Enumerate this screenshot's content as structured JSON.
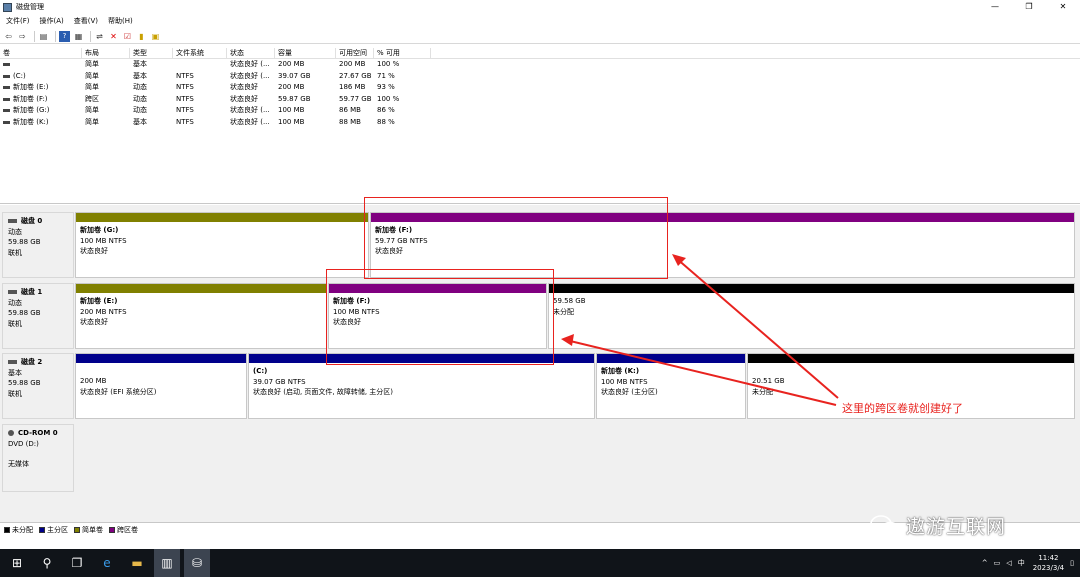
{
  "window": {
    "title": "磁盘管理",
    "controls": [
      "—",
      "❐",
      "✕"
    ]
  },
  "menu": [
    "文件(F)",
    "操作(A)",
    "查看(V)",
    "帮助(H)"
  ],
  "toolbar_icons": [
    "back-icon",
    "forward-icon",
    "list-icon",
    "help-icon",
    "properties-icon",
    "connect-icon",
    "delete-icon",
    "check-icon",
    "open-icon",
    "explore-icon"
  ],
  "volume_list": {
    "headers": [
      "卷",
      "布局",
      "类型",
      "文件系统",
      "状态",
      "容量",
      "可用空间",
      "% 可用"
    ],
    "rows": [
      [
        "",
        "简单",
        "基本",
        "",
        "状态良好 (...",
        "200 MB",
        "200 MB",
        "100 %"
      ],
      [
        "(C:)",
        "简单",
        "基本",
        "NTFS",
        "状态良好 (...",
        "39.07 GB",
        "27.67 GB",
        "71 %"
      ],
      [
        "新加卷 (E:)",
        "简单",
        "动态",
        "NTFS",
        "状态良好",
        "200 MB",
        "186 MB",
        "93 %"
      ],
      [
        "新加卷 (F:)",
        "跨区",
        "动态",
        "NTFS",
        "状态良好",
        "59.87 GB",
        "59.77 GB",
        "100 %"
      ],
      [
        "新加卷 (G:)",
        "简单",
        "动态",
        "NTFS",
        "状态良好 (...",
        "100 MB",
        "86 MB",
        "86 %"
      ],
      [
        "新加卷 (K:)",
        "简单",
        "基本",
        "NTFS",
        "状态良好 (...",
        "100 MB",
        "88 MB",
        "88 %"
      ]
    ]
  },
  "disks": {
    "disk0": {
      "name": "磁盘 0",
      "type": "动态",
      "size": "59.88 GB",
      "status": "联机",
      "p1": {
        "title": "新加卷  (G:)",
        "size": "100 MB NTFS",
        "status": "状态良好"
      },
      "p2": {
        "title": "新加卷  (F:)",
        "size": "59.77 GB NTFS",
        "status": "状态良好"
      }
    },
    "disk1": {
      "name": "磁盘 1",
      "type": "动态",
      "size": "59.88 GB",
      "status": "联机",
      "p1": {
        "title": "新加卷  (E:)",
        "size": "200 MB NTFS",
        "status": "状态良好"
      },
      "p2": {
        "title": "新加卷  (F:)",
        "size": "100 MB NTFS",
        "status": "状态良好"
      },
      "p3": {
        "size": "59.58 GB",
        "status": "未分配"
      }
    },
    "disk2": {
      "name": "磁盘 2",
      "type": "基本",
      "size": "59.88 GB",
      "status": "联机",
      "p1": {
        "size": "200 MB",
        "status": "状态良好 (EFI 系统分区)"
      },
      "p2": {
        "title": "(C:)",
        "size": "39.07 GB NTFS",
        "status": "状态良好 (启动, 页面文件, 故障转储, 主分区)"
      },
      "p3": {
        "title": "新加卷  (K:)",
        "size": "100 MB NTFS",
        "status": "状态良好 (主分区)"
      },
      "p4": {
        "size": "20.51 GB",
        "status": "未分配"
      }
    },
    "cdrom": {
      "name": "CD-ROM 0",
      "type": "DVD (D:)",
      "status": "无媒体"
    }
  },
  "legend": [
    "未分配",
    "主分区",
    "简单卷",
    "跨区卷"
  ],
  "colors": {
    "unallocated": "#000000",
    "primary": "#00008b",
    "simple": "#808000",
    "spanned": "#800080",
    "annotation": "#e8231f"
  },
  "annotation": "这里的跨区卷就创建好了",
  "tray": {
    "ime": "中",
    "time": "11:42",
    "date": "2023/3/4"
  },
  "watermark": "遨游互联网"
}
